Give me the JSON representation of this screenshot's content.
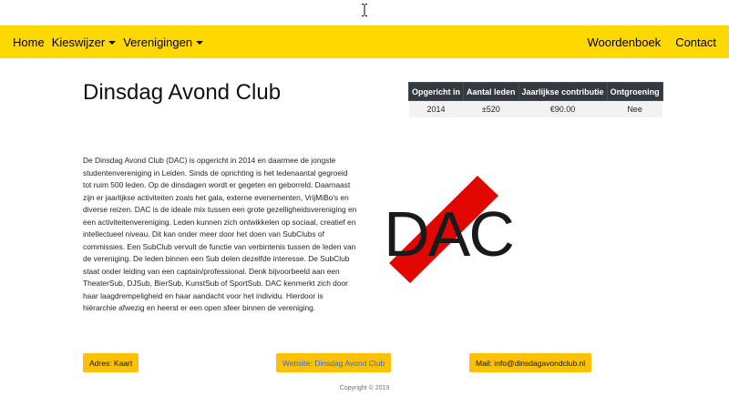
{
  "nav": {
    "left": [
      {
        "label": "Home",
        "dropdown": false
      },
      {
        "label": "Kieswijzer",
        "dropdown": true
      },
      {
        "label": "Verenigingen",
        "dropdown": true
      }
    ],
    "right": [
      {
        "label": "Woordenboek"
      },
      {
        "label": "Contact"
      }
    ],
    "background": "#ffd800"
  },
  "page": {
    "title": "Dinsdag Avond Club"
  },
  "info_table": {
    "headers": [
      "Opgericht in",
      "Aantal leden",
      "Jaarlijkse contributie",
      "Ontgroening"
    ],
    "row": [
      "2014",
      "±520",
      "€90.00",
      "Nee"
    ]
  },
  "description": "De Dinsdag Avond Club (DAC) is opgericht in 2014 en daarmee de jongste studentenvereniging in Leiden. Sinds de oprichting is het ledenaantal gegroeid tot ruim 500 leden. Op de dinsdagen wordt er gegeten en geborreld. Daarnaast zijn er jaarlijkse activiteiten zoals het gala, externe evenementen, VrijMiBo's en diverse reizen. DAC is de ideale mix tussen een grote gezelligheidsvereniging en een activiteitenvereniging. Leden kunnen zich ontwikkelen op sociaal, creatief en intellectueel niveau. Dit kan onder meer door het doen van SubClubs of commissies. Een SubClub vervult de functie van verbintenis tussen de leden van de vereniging. De leden binnen een Sub delen dezelfde interesse. De SubClub staat onder leiding van een captain/professional. Denk bijvoorbeeld aan een TheaterSub, DJSub, BierSub, KunstSub of SportSub. DAC kenmerkt zich door haar laagdrempeligheid en haar aandacht voor het individu. Hierdoor is hiërarchie afwezig en heerst er een open sfeer binnen de vereniging.",
  "logo": {
    "text": "DAC",
    "bar_color": "#e10600",
    "text_color": "#1a1a1a"
  },
  "buttons": {
    "adres": "Adres: Kaart",
    "website": "Website: Dinsdag Avond Club",
    "mail": "Mail: info@dinsdagavondclub.nl"
  },
  "footer": "Copyright © 2019",
  "colors": {
    "button": "#ffc107",
    "table_header": "#343a40",
    "link": "#2a6be0"
  }
}
